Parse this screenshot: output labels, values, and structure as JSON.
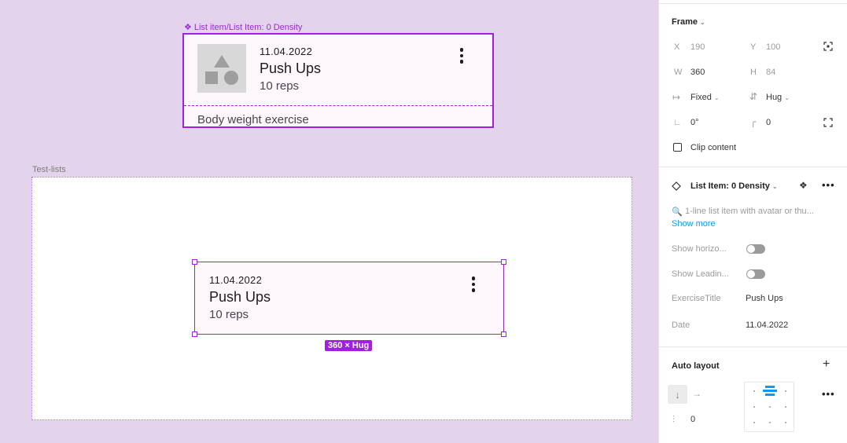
{
  "canvas": {
    "component_label": "List item/List Item: 0 Density",
    "component_card": {
      "date": "11.04.2022",
      "title": "Push Ups",
      "reps": "10 reps",
      "subtitle": "Body weight exercise"
    },
    "frame_name": "Test-lists",
    "instance_card": {
      "date": "11.04.2022",
      "title": "Push Ups",
      "reps": "10 reps"
    },
    "size_badge": "360 × Hug"
  },
  "panel": {
    "frame": {
      "header": "Frame",
      "x_label": "X",
      "x_value": "190",
      "y_label": "Y",
      "y_value": "100",
      "w_label": "W",
      "w_value": "360",
      "h_label": "H",
      "h_value": "84",
      "width_mode": "Fixed",
      "height_mode": "Hug",
      "rotation": "0°",
      "radius": "0",
      "clip_content": "Clip content"
    },
    "component": {
      "name": "List Item: 0 Density",
      "description": "1-line list item with avatar or thu...",
      "show_more": "Show more",
      "props": [
        {
          "label": "Show horizo...",
          "type": "toggle"
        },
        {
          "label": "Show Leadin...",
          "type": "toggle"
        },
        {
          "label": "ExerciseTitle",
          "value": "Push Ups"
        },
        {
          "label": "Date",
          "value": "11.04.2022"
        }
      ]
    },
    "auto_layout": {
      "header": "Auto layout",
      "gap_value": "0"
    }
  },
  "colors": {
    "canvas_bg": "#e3d3ec",
    "selection": "#a020e0",
    "card_bg": "#fdf6fb",
    "accent_link": "#0d99ff"
  }
}
